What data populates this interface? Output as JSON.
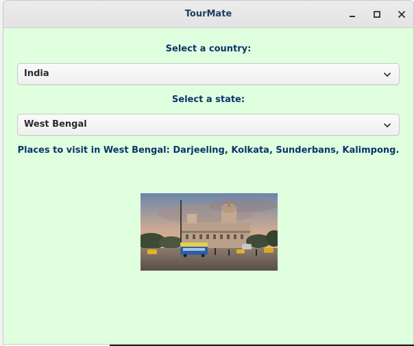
{
  "window": {
    "title": "TourMate",
    "minimize_icon": "minimize-icon",
    "maximize_icon": "maximize-icon",
    "close_icon": "close-icon"
  },
  "country": {
    "label": "Select a country:",
    "selected": "India"
  },
  "state": {
    "label": "Select a state:",
    "selected": "West Bengal"
  },
  "places_text": "Places to visit in West Bengal: Darjeeling, Kolkata, Sunderbans, Kalimpong.",
  "colors": {
    "content_bg": "#dfffdf",
    "label_color": "#0a3568",
    "title_color": "#1f3b63"
  }
}
